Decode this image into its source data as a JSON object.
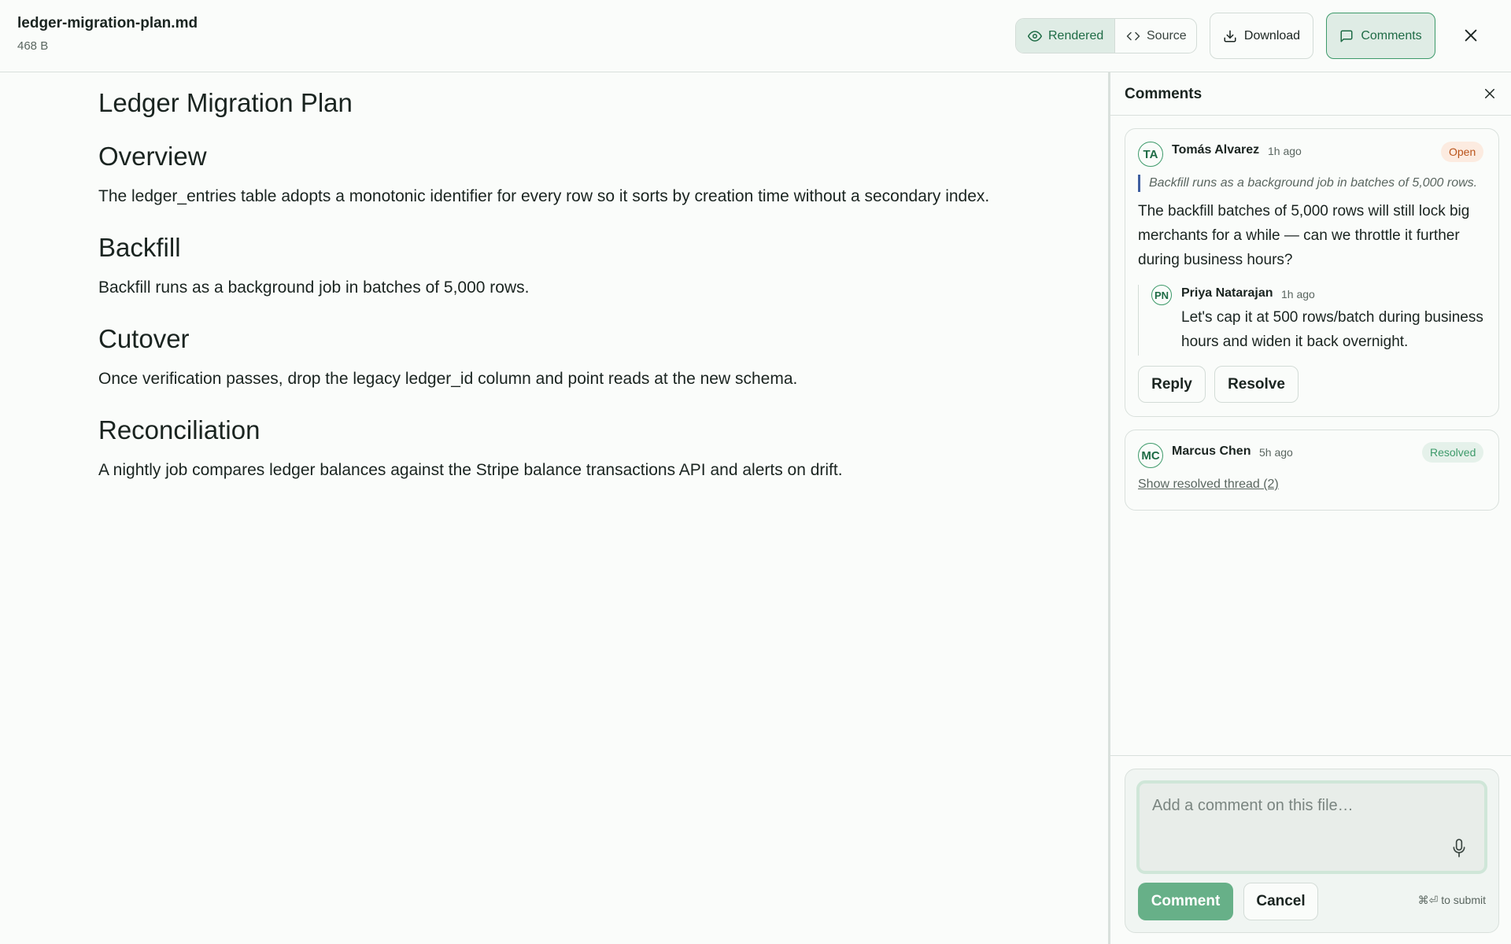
{
  "header": {
    "file_name": "ledger-migration-plan.md",
    "file_size": "468 B",
    "view_toggle": {
      "rendered_label": "Rendered",
      "source_label": "Source",
      "selected": "Rendered"
    },
    "download_label": "Download",
    "comments_label": "Comments"
  },
  "document": {
    "title": "Ledger Migration Plan",
    "sections": [
      {
        "heading": "Overview",
        "text": "The ledger_entries table adopts a monotonic identifier for every row so it sorts by creation time without a secondary index."
      },
      {
        "heading": "Backfill",
        "text": "Backfill runs as a background job in batches of 5,000 rows."
      },
      {
        "heading": "Cutover",
        "text": "Once verification passes, drop the legacy ledger_id column and point reads at the new schema."
      },
      {
        "heading": "Reconciliation",
        "text": "A nightly job compares ledger balances against the Stripe balance transactions API and alerts on drift."
      }
    ]
  },
  "comments_panel": {
    "title": "Comments",
    "threads": [
      {
        "initials": "TA",
        "author": "Tomás Alvarez",
        "time": "1h ago",
        "status": "Open",
        "quote": "Backfill runs as a background job in batches of 5,000 rows.",
        "body": "The backfill batches of 5,000 rows will still lock big merchants for a while — can we throttle it further during business hours?",
        "reply": {
          "initials": "PN",
          "author": "Priya Natarajan",
          "time": "1h ago",
          "body": "Let's cap it at 500 rows/batch during business hours and widen it back overnight."
        },
        "reply_label": "Reply",
        "resolve_label": "Resolve"
      },
      {
        "initials": "MC",
        "author": "Marcus Chen",
        "time": "5h ago",
        "status": "Resolved",
        "show_thread_label": "Show resolved thread (2)"
      }
    ],
    "composer": {
      "placeholder": "Add a comment on this file…",
      "value": "",
      "comment_label": "Comment",
      "cancel_label": "Cancel",
      "hint": "⌘⏎ to submit"
    }
  },
  "colors": {
    "accent": "#3d9a6a",
    "accent_dark": "#1e6b45",
    "open_badge": "#b9531a",
    "quote_bar": "#3f5fa0"
  }
}
